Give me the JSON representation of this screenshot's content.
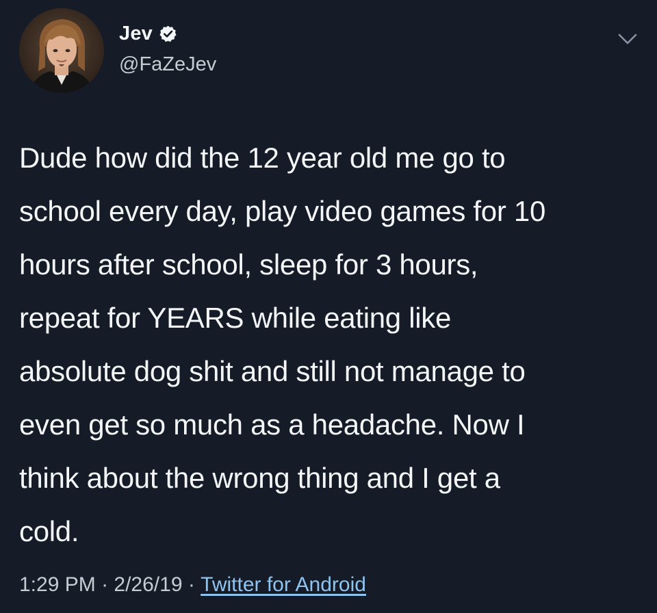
{
  "user": {
    "display_name": "Jev",
    "handle": "@FaZeJev",
    "verified": true
  },
  "tweet": {
    "text": "Dude how did the 12 year old me go to\nschool every day, play video games for 10\nhours after school, sleep for 3 hours,\nrepeat for YEARS while eating like\nabsolute dog shit and still not manage to\neven get so much as a headache. Now I\nthink about the wrong thing and I get a\ncold.",
    "time": "1:29 PM",
    "separator": " · ",
    "date": "2/26/19",
    "source": "Twitter for Android"
  },
  "icons": {
    "verified": "verified-badge-icon",
    "more": "chevron-down-icon"
  },
  "colors": {
    "background": "#151c27",
    "text": "#f4f6f8",
    "secondary_text": "#c7ccd2",
    "link": "#8fc3f0"
  }
}
